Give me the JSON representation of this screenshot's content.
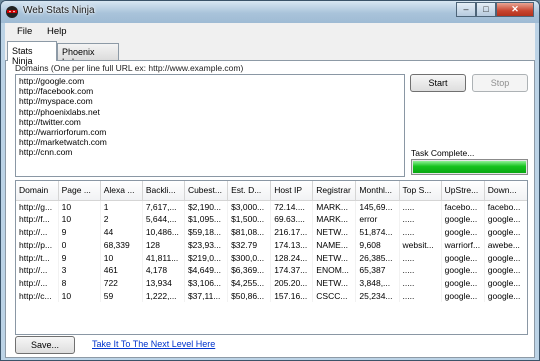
{
  "window": {
    "title": "Web Stats Ninja",
    "controls": [
      "–",
      "□",
      "✕"
    ]
  },
  "menu": [
    "File",
    "Help"
  ],
  "tabs": [
    "Stats Ninja",
    "Phoenix Labs"
  ],
  "domains": {
    "label": "Domains (One per line full URL ex: http://www.example.com)",
    "lines": [
      "http://google.com",
      "http://facebook.com",
      "http://myspace.com",
      "http://phoenixlabs.net",
      "http://twitter.com",
      "http://warriorforum.com",
      "http://marketwatch.com",
      "http://cnn.com"
    ]
  },
  "buttons": {
    "start": "Start",
    "stop": "Stop",
    "save": "Save..."
  },
  "status": {
    "text": "Task Complete...",
    "progress_percent": 100,
    "bar_color": "#15c31d"
  },
  "table": {
    "columns": [
      "Domain",
      "Page ...",
      "Alexa ...",
      "Backli...",
      "Cubest...",
      "Est. D...",
      "Host IP",
      "Registrar",
      "Monthl...",
      "Top S...",
      "UpStre...",
      "Down..."
    ],
    "rows": [
      [
        "http://g...",
        "10",
        "1",
        "7,617,...",
        "$2,190...",
        "$3,000...",
        "72.14....",
        "MARK...",
        "145,69...",
        ".....",
        "facebo...",
        "facebo..."
      ],
      [
        "http://f...",
        "10",
        "2",
        "5,644,...",
        "$1,095...",
        "$1,500...",
        "69.63....",
        "MARK...",
        "error",
        ".....",
        "google...",
        "google..."
      ],
      [
        "http://...",
        "9",
        "44",
        "10,486...",
        "$59,18...",
        "$81,08...",
        "216.17...",
        "NETW...",
        "51,874...",
        ".....",
        "google...",
        "google..."
      ],
      [
        "http://p...",
        "0",
        "68,339",
        "128",
        "$23,93...",
        "$32.79",
        "174.13...",
        "NAME...",
        "9,608",
        "websit...",
        "warriorf...",
        "awebe..."
      ],
      [
        "http://t...",
        "9",
        "10",
        "41,811...",
        "$219,0...",
        "$300,0...",
        "128.24...",
        "NETW...",
        "26,385...",
        ".....",
        "google...",
        "google..."
      ],
      [
        "http://...",
        "3",
        "461",
        "4,178",
        "$4,649...",
        "$6,369...",
        "174.37...",
        "ENOM...",
        "65,387",
        ".....",
        "google...",
        "google..."
      ],
      [
        "http://...",
        "8",
        "722",
        "13,934",
        "$3,106...",
        "$4,255...",
        "205.20...",
        "NETW...",
        "3,848,...",
        ".....",
        "google...",
        "google..."
      ],
      [
        "http://c...",
        "10",
        "59",
        "1,222,...",
        "$37,11...",
        "$50,86...",
        "157.16...",
        "CSCC...",
        "25,234...",
        ".....",
        "google...",
        "google..."
      ]
    ]
  },
  "link": {
    "text": "Take It To The Next Level Here"
  }
}
